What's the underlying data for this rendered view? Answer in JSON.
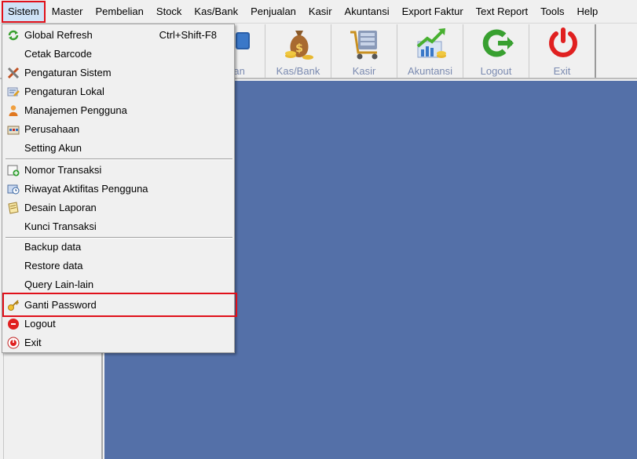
{
  "menubar": {
    "items": [
      {
        "label": "Sistem"
      },
      {
        "label": "Master"
      },
      {
        "label": "Pembelian"
      },
      {
        "label": "Stock"
      },
      {
        "label": "Kas/Bank"
      },
      {
        "label": "Penjualan"
      },
      {
        "label": "Kasir"
      },
      {
        "label": "Akuntansi"
      },
      {
        "label": "Export Faktur"
      },
      {
        "label": "Text Report"
      },
      {
        "label": "Tools"
      },
      {
        "label": "Help"
      }
    ]
  },
  "toolbar": {
    "buttons": [
      {
        "label": "Penjualan",
        "icon": "shopping-bag-icon"
      },
      {
        "label": "Kas/Bank",
        "icon": "money-bag-icon"
      },
      {
        "label": "Kasir",
        "icon": "cash-register-cart-icon"
      },
      {
        "label": "Akuntansi",
        "icon": "chart-growth-icon"
      },
      {
        "label": "Logout",
        "icon": "logout-arrow-icon"
      },
      {
        "label": "Exit",
        "icon": "power-icon"
      }
    ],
    "partial_visible_label": "ualan"
  },
  "dropdown": {
    "items": [
      {
        "label": "Global Refresh",
        "shortcut": "Ctrl+Shift-F8",
        "icon": "refresh-icon"
      },
      {
        "label": "Cetak Barcode",
        "shortcut": "",
        "icon": ""
      },
      {
        "label": "Pengaturan Sistem",
        "shortcut": "",
        "icon": "tools-icon"
      },
      {
        "label": "Pengaturan Lokal",
        "shortcut": "",
        "icon": "local-settings-icon"
      },
      {
        "label": "Manajemen Pengguna",
        "shortcut": "",
        "icon": "user-icon"
      },
      {
        "label": "Perusahaan",
        "shortcut": "",
        "icon": "company-icon"
      },
      {
        "label": "Setting Akun",
        "shortcut": "",
        "icon": ""
      },
      {
        "label": "Nomor Transaksi",
        "shortcut": "",
        "icon": "add-number-icon"
      },
      {
        "label": "Riwayat Aktifitas Pengguna",
        "shortcut": "",
        "icon": "history-icon"
      },
      {
        "label": "Desain Laporan",
        "shortcut": "",
        "icon": "report-design-icon"
      },
      {
        "label": "Kunci Transaksi",
        "shortcut": "",
        "icon": ""
      },
      {
        "label": "Backup data",
        "shortcut": "",
        "icon": ""
      },
      {
        "label": "Restore data",
        "shortcut": "",
        "icon": ""
      },
      {
        "label": "Query Lain-lain",
        "shortcut": "",
        "icon": ""
      },
      {
        "label": "Ganti Password",
        "shortcut": "",
        "icon": "key-icon"
      },
      {
        "label": "Logout",
        "shortcut": "",
        "icon": "logout-icon"
      },
      {
        "label": "Exit",
        "shortcut": "",
        "icon": "exit-icon"
      }
    ]
  },
  "colors": {
    "workspace": "#5470a8",
    "highlight": "#e0101a",
    "toolbar_label": "#7a8ab0"
  }
}
